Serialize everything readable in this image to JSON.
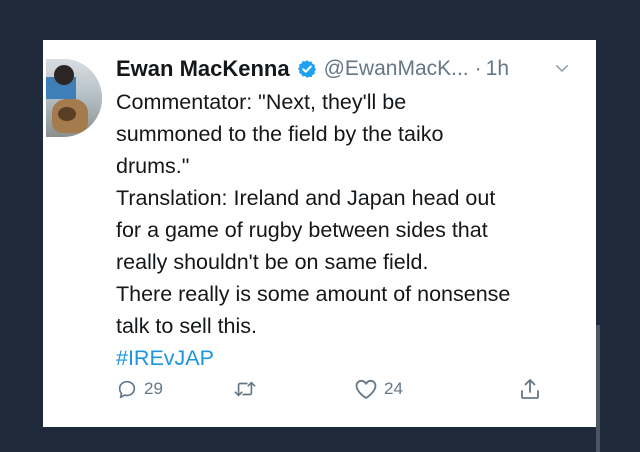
{
  "tweet": {
    "author_name": "Ewan MacKenna",
    "handle": "@EwanMacK...",
    "separator": "·",
    "time": "1h",
    "lines": [
      "Commentator: \"Next, they'll be",
      "summoned to the field by the taiko",
      "drums.\"",
      "Translation: Ireland and Japan head out",
      "for a game of rugby between sides that",
      "really shouldn't be on same field.",
      "There really is some amount of nonsense",
      "talk to sell this."
    ],
    "hashtag": "#IREvJAP"
  },
  "actions": {
    "reply_count": "29",
    "retweet_count": "",
    "like_count": "24"
  },
  "colors": {
    "background": "#1f2b3a",
    "card": "#ffffff",
    "text": "#14171a",
    "muted": "#657786",
    "link": "#1b95e0",
    "verified": "#1da1f2"
  },
  "icons": [
    "verified-badge-icon",
    "chevron-down-icon",
    "reply-icon",
    "retweet-icon",
    "like-icon",
    "share-icon"
  ]
}
